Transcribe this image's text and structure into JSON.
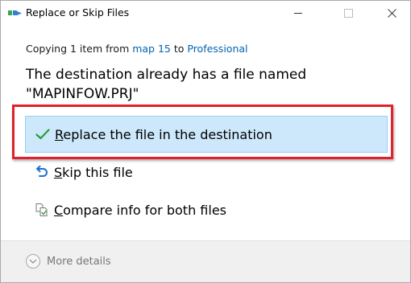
{
  "window": {
    "title": "Replace or Skip Files",
    "controls": {
      "minimize_icon": "minimize-icon",
      "maximize_icon": "maximize-icon",
      "close_icon": "close-icon"
    }
  },
  "copying": {
    "prefix": "Copying 1 item from ",
    "source": "map 15",
    "middle": " to ",
    "destination": "Professional"
  },
  "heading": {
    "line1": "The destination already has a file named",
    "line2": "\"MAPINFOW.PRJ\""
  },
  "options": [
    {
      "id": "replace",
      "access_key": "R",
      "rest": "eplace the file in the destination",
      "icon": "checkmark-icon",
      "selected": true
    },
    {
      "id": "skip",
      "access_key": "S",
      "rest": "kip this file",
      "icon": "undo-arrow-icon",
      "selected": false
    },
    {
      "id": "compare",
      "access_key": "C",
      "rest": "ompare info for both files",
      "icon": "compare-files-icon",
      "selected": false
    }
  ],
  "footer": {
    "more_details": "More details",
    "icon": "chevron-down-circle-icon"
  },
  "colors": {
    "link": "#0063b1",
    "selected_bg": "#cde8fa",
    "selected_border": "#99d1f5",
    "highlight": "#e2212a",
    "check": "#2a9d3a",
    "skip_arrow": "#1e6fd0"
  }
}
